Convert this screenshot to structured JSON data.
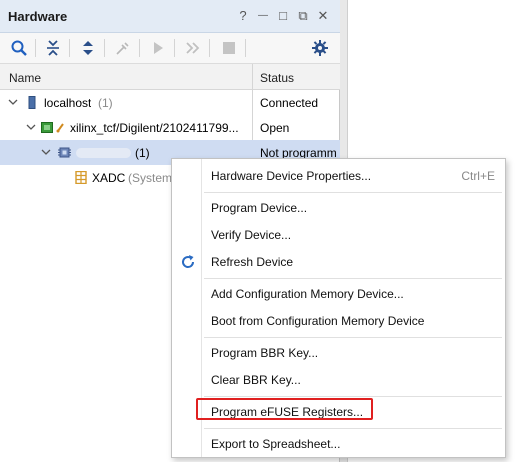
{
  "panel": {
    "title": "Hardware",
    "help_glyph": "?",
    "minimize_glyph": "—",
    "restore_glyph": "□",
    "float_glyph": "⧉",
    "close_glyph": "✕"
  },
  "toolbar": {
    "icons": [
      "search-icon",
      "collapse-all-icon",
      "expand-all-icon",
      "plug-icon",
      "run-icon",
      "step-icon",
      "stop-icon",
      "gear-icon"
    ]
  },
  "table": {
    "columns": [
      "Name",
      "Status"
    ],
    "rows": [
      {
        "name": "localhost",
        "suffix": "(1)",
        "status": "Connected"
      },
      {
        "name": "xilinx_tcf/Digilent/2102411799...",
        "suffix": "",
        "status": "Open"
      },
      {
        "name": "",
        "suffix": "(1)",
        "status": "Not programm"
      },
      {
        "name": "XADC",
        "suffix": "(System",
        "status": ""
      }
    ]
  },
  "menu": {
    "items": [
      {
        "label": "Hardware Device Properties...",
        "shortcut": "Ctrl+E"
      },
      {
        "label": "Program Device..."
      },
      {
        "label": "Verify Device..."
      },
      {
        "label": "Refresh Device",
        "icon": "refresh-icon"
      },
      {
        "label": "Add Configuration Memory Device..."
      },
      {
        "label": "Boot from Configuration Memory Device"
      },
      {
        "label": "Program BBR Key..."
      },
      {
        "label": "Clear BBR Key..."
      },
      {
        "label": "Program eFUSE Registers..."
      },
      {
        "label": "Export to Spreadsheet..."
      }
    ]
  },
  "colors": {
    "title_bar": "#e3ebf5",
    "selection": "#cfdcf2",
    "highlight_box": "#e02020",
    "accent_blue": "#2a6bc2"
  }
}
